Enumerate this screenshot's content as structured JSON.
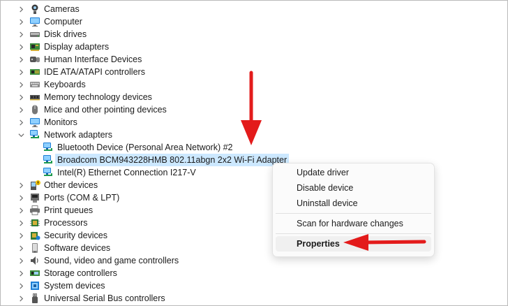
{
  "tree": {
    "categories_top": [
      {
        "label": "Cameras",
        "icon": "camera-icon"
      },
      {
        "label": "Computer",
        "icon": "monitor-icon"
      },
      {
        "label": "Disk drives",
        "icon": "disk-drive-icon"
      },
      {
        "label": "Display adapters",
        "icon": "display-adapter-icon"
      },
      {
        "label": "Human Interface Devices",
        "icon": "hid-icon"
      },
      {
        "label": "IDE ATA/ATAPI controllers",
        "icon": "ide-controller-icon"
      },
      {
        "label": "Keyboards",
        "icon": "keyboard-icon"
      },
      {
        "label": "Memory technology devices",
        "icon": "memory-icon"
      },
      {
        "label": "Mice and other pointing devices",
        "icon": "mouse-icon"
      },
      {
        "label": "Monitors",
        "icon": "monitor-icon"
      }
    ],
    "network": {
      "label": "Network adapters",
      "icon": "network-adapter-icon",
      "children": [
        {
          "label": "Bluetooth Device (Personal Area Network) #2",
          "icon": "network-adapter-icon"
        },
        {
          "label": "Broadcom BCM943228HMB 802.11abgn 2x2 Wi-Fi Adapter",
          "icon": "network-adapter-icon",
          "selected": true
        },
        {
          "label": "Intel(R) Ethernet Connection I217-V",
          "icon": "network-adapter-icon"
        }
      ]
    },
    "categories_bottom": [
      {
        "label": "Other devices",
        "icon": "other-device-icon"
      },
      {
        "label": "Ports (COM & LPT)",
        "icon": "port-icon"
      },
      {
        "label": "Print queues",
        "icon": "printer-icon"
      },
      {
        "label": "Processors",
        "icon": "processor-icon"
      },
      {
        "label": "Security devices",
        "icon": "security-device-icon"
      },
      {
        "label": "Software devices",
        "icon": "software-device-icon"
      },
      {
        "label": "Sound, video and game controllers",
        "icon": "speaker-icon"
      },
      {
        "label": "Storage controllers",
        "icon": "storage-controller-icon"
      },
      {
        "label": "System devices",
        "icon": "system-device-icon"
      },
      {
        "label": "Universal Serial Bus controllers",
        "icon": "usb-icon"
      }
    ]
  },
  "context_menu": {
    "items": [
      {
        "label": "Update driver"
      },
      {
        "label": "Disable device"
      },
      {
        "label": "Uninstall device"
      },
      {
        "label": "Scan for hardware changes"
      },
      {
        "label": "Properties",
        "bold": true
      }
    ]
  },
  "annotations": {
    "arrow_color": "#e31b1b"
  }
}
